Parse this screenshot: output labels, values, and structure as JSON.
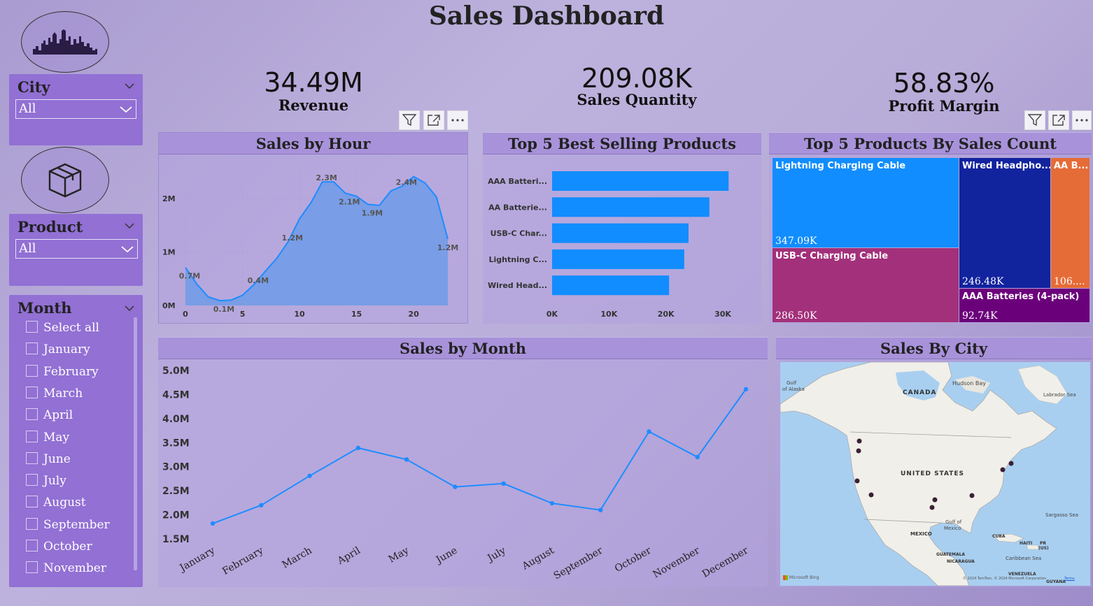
{
  "title": "Sales Dashboard",
  "kpis": [
    {
      "value": "34.49M",
      "label": "Revenue"
    },
    {
      "value": "209.08K",
      "label": "Sales Quantity"
    },
    {
      "value": "58.83%",
      "label": "Profit Margin"
    }
  ],
  "slicers": {
    "city": {
      "title": "City",
      "selected": "All"
    },
    "product": {
      "title": "Product",
      "selected": "All"
    },
    "month": {
      "title": "Month",
      "items": [
        "Select all",
        "January",
        "February",
        "March",
        "April",
        "May",
        "June",
        "July",
        "August",
        "September",
        "October",
        "November"
      ]
    }
  },
  "icons": {
    "skyline": "city-skyline-icon",
    "box": "product-box-icon",
    "filter": "filter-icon",
    "focus": "focus-mode-icon",
    "more": "more-options-icon"
  },
  "colors": {
    "accent": "#1e8cff",
    "slicer": "#9270d4",
    "treemap": [
      "#118dff",
      "#12239e",
      "#e66c37",
      "#a3307a",
      "#6b007b"
    ]
  },
  "sales_by_hour": {
    "title": "Sales by Hour",
    "chart_data": {
      "type": "area",
      "x": [
        0,
        1,
        2,
        3,
        4,
        5,
        6,
        7,
        8,
        9,
        10,
        11,
        12,
        13,
        14,
        15,
        16,
        17,
        18,
        19,
        20,
        21,
        22,
        23
      ],
      "values": [
        0.71,
        0.4,
        0.16,
        0.09,
        0.1,
        0.19,
        0.39,
        0.64,
        0.88,
        1.19,
        1.62,
        1.92,
        2.31,
        2.31,
        2.1,
        2.04,
        1.89,
        1.87,
        2.14,
        2.23,
        2.41,
        2.29,
        2.03,
        1.24
      ],
      "data_labels": [
        {
          "x": 0,
          "text": "0.7M"
        },
        {
          "x": 3,
          "text": "0.1M"
        },
        {
          "x": 6,
          "text": "0.4M"
        },
        {
          "x": 9,
          "text": "1.2M"
        },
        {
          "x": 12,
          "text": "2.3M"
        },
        {
          "x": 14,
          "text": "2.1M"
        },
        {
          "x": 16,
          "text": "1.9M"
        },
        {
          "x": 19,
          "text": "2.4M"
        },
        {
          "x": 23,
          "text": "1.2M"
        }
      ],
      "x_ticks": [
        "0",
        "5",
        "10",
        "15",
        "20"
      ],
      "y_ticks": [
        "0M",
        "1M",
        "2M"
      ],
      "ylim": [
        0,
        2.6
      ],
      "xlim": [
        0,
        23
      ]
    }
  },
  "top5_best": {
    "title": "Top 5 Best Selling Products",
    "chart_data": {
      "type": "bar",
      "categories": [
        "AAA Batteri...",
        "AA Batterie...",
        "USB-C Char...",
        "Lightning C...",
        "Wired Head..."
      ],
      "values": [
        31017,
        27635,
        23975,
        23217,
        20557
      ],
      "x_ticks": [
        "0K",
        "10K",
        "20K",
        "30K"
      ],
      "xlim": [
        0,
        30000
      ]
    }
  },
  "top5_count": {
    "title": "Top 5 Products By Sales Count",
    "chart_data": {
      "type": "treemap",
      "items": [
        {
          "name": "Lightning Charging Cable",
          "value_label": "347.09K"
        },
        {
          "name": "USB-C Charging Cable",
          "value_label": "286.50K"
        },
        {
          "name": "Wired Headpho...",
          "value_label": "246.48K"
        },
        {
          "name": "AAA Batteries (4-pack)",
          "value_label": "92.74K"
        },
        {
          "name": "AA B...",
          "value_label": "106...."
        }
      ]
    }
  },
  "sales_by_month": {
    "title": "Sales by Month",
    "chart_data": {
      "type": "line",
      "categories": [
        "January",
        "February",
        "March",
        "April",
        "May",
        "June",
        "July",
        "August",
        "September",
        "October",
        "November",
        "December"
      ],
      "values": [
        1.82,
        2.2,
        2.81,
        3.39,
        3.15,
        2.58,
        2.65,
        2.24,
        2.1,
        3.73,
        3.2,
        4.61
      ],
      "y_ticks": [
        "1.5M",
        "2.0M",
        "2.5M",
        "3.0M",
        "3.5M",
        "4.0M",
        "4.5M",
        "5.0M"
      ],
      "ylim": [
        1.5,
        5.0
      ]
    }
  },
  "sales_by_city": {
    "title": "Sales By City",
    "labels": {
      "gulf_alaska_1": "Gulf",
      "gulf_alaska_2": "of Alaska",
      "hudson": "Hudson Bay",
      "canada": "CANADA",
      "labrador": "Labrador Sea",
      "us": "UNITED STATES",
      "sargasso": "Sargasso Sea",
      "gulf_mexico_1": "Gulf of",
      "gulf_mexico_2": "Mexico",
      "mexico": "MEXICO",
      "cuba": "CUBA",
      "haiti": "HAITI",
      "pr": "PR",
      "pr_us": "(US)",
      "caribbean": "Caribbean Sea",
      "guatemala": "GUATEMALA",
      "nicaragua": "NICARAGUA",
      "venezuela": "VENEZUELA",
      "guyana": "GUYANA",
      "bing": "Microsoft Bing",
      "copyright": "© 2024 TomTom, © 2024 Microsoft Corporation",
      "terms": "Terms"
    }
  }
}
